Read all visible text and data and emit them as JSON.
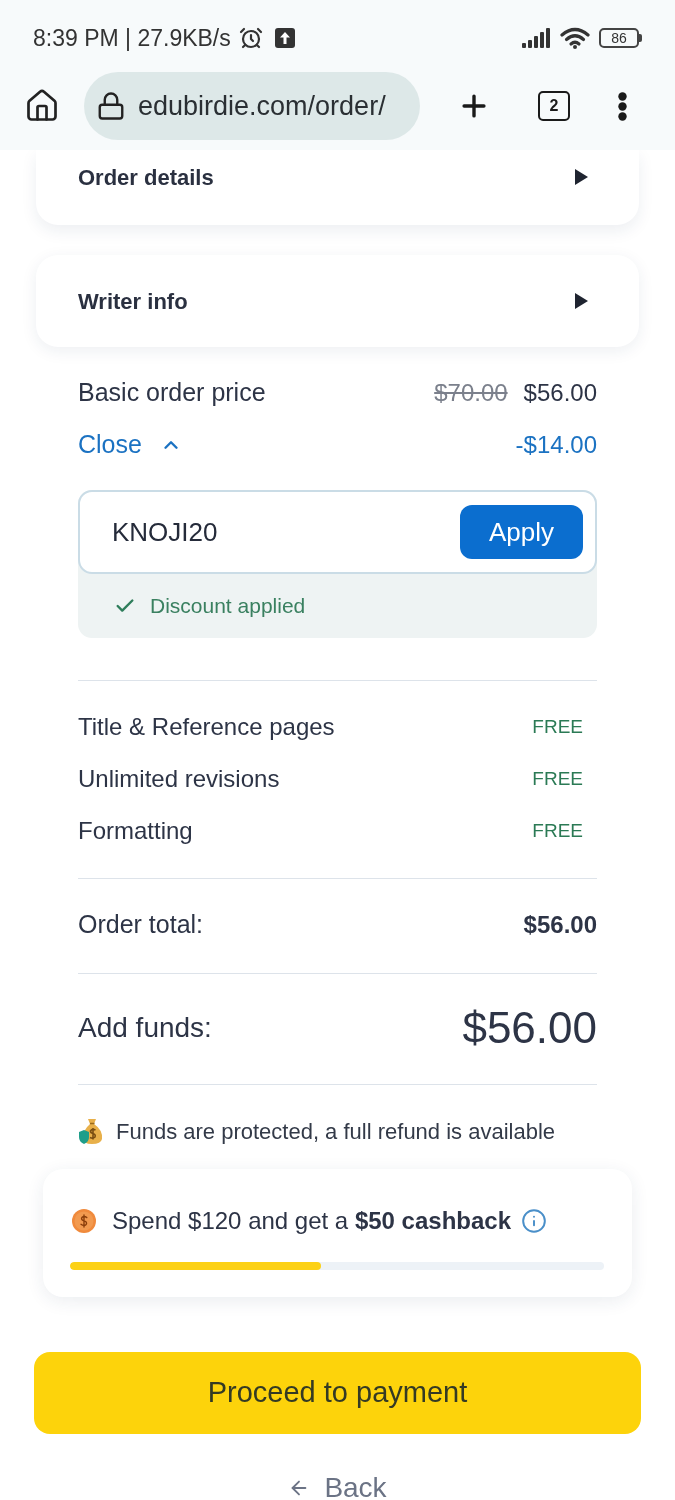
{
  "status_bar": {
    "time": "8:39 PM | 27.9KB/s",
    "battery": "86"
  },
  "browser": {
    "url": "edubirdie.com/order/",
    "tab_count": "2"
  },
  "sections": [
    {
      "title": "Order details",
      "expanded": false
    },
    {
      "title": "Writer info",
      "expanded": false
    }
  ],
  "price": {
    "label": "Basic order price",
    "old_price": "$70.00",
    "price": "$56.00"
  },
  "discount": {
    "toggle": "Close",
    "expanded": true,
    "amount": "-$14.00",
    "code": "KNOJI20",
    "button": "Apply",
    "status": "Discount applied"
  },
  "extras": [
    {
      "label": "Title & Reference pages",
      "value": "FREE"
    },
    {
      "label": "Unlimited revisions",
      "value": "FREE"
    },
    {
      "label": "Formatting",
      "value": "FREE"
    }
  ],
  "order_total": {
    "label": "Order total:",
    "value": "$56.00"
  },
  "add_funds": {
    "label": "Add funds:",
    "value": "$56.00"
  },
  "protection_note": "Funds are protected, a full refund is available",
  "cashback": {
    "text": "Spend $120 and get a **$50 cashback**",
    "level": 0.47
  },
  "actions": {
    "proceed": "Proceed to payment",
    "back": "Back"
  }
}
